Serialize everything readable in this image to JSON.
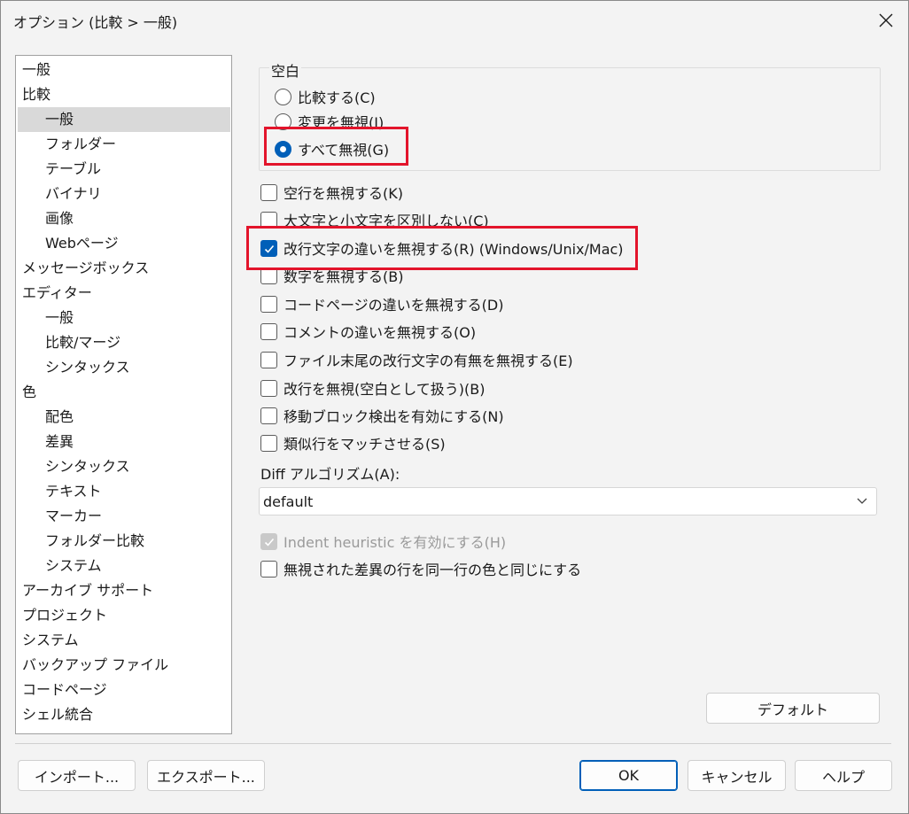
{
  "window": {
    "title": "オプション (比較 > 一般)"
  },
  "tree": [
    {
      "label": "一般",
      "level": 0
    },
    {
      "label": "比較",
      "level": 0
    },
    {
      "label": "一般",
      "level": 1,
      "selected": true
    },
    {
      "label": "フォルダー",
      "level": 1
    },
    {
      "label": "テーブル",
      "level": 1
    },
    {
      "label": "バイナリ",
      "level": 1
    },
    {
      "label": "画像",
      "level": 1
    },
    {
      "label": "Webページ",
      "level": 1
    },
    {
      "label": "メッセージボックス",
      "level": 0
    },
    {
      "label": "エディター",
      "level": 0
    },
    {
      "label": "一般",
      "level": 1
    },
    {
      "label": "比較/マージ",
      "level": 1
    },
    {
      "label": "シンタックス",
      "level": 1
    },
    {
      "label": "色",
      "level": 0
    },
    {
      "label": "配色",
      "level": 1
    },
    {
      "label": "差異",
      "level": 1
    },
    {
      "label": "シンタックス",
      "level": 1
    },
    {
      "label": "テキスト",
      "level": 1
    },
    {
      "label": "マーカー",
      "level": 1
    },
    {
      "label": "フォルダー比較",
      "level": 1
    },
    {
      "label": "システム",
      "level": 1
    },
    {
      "label": "アーカイブ サポート",
      "level": 0
    },
    {
      "label": "プロジェクト",
      "level": 0
    },
    {
      "label": "システム",
      "level": 0
    },
    {
      "label": "バックアップ ファイル",
      "level": 0
    },
    {
      "label": "コードページ",
      "level": 0
    },
    {
      "label": "シェル統合",
      "level": 0
    }
  ],
  "whitespace": {
    "label": "空白",
    "options": [
      {
        "label": "比較する(C)",
        "checked": false
      },
      {
        "label": "変更を無視(I)",
        "checked": false
      },
      {
        "label": "すべて無視(G)",
        "checked": true
      }
    ]
  },
  "checkboxes": [
    {
      "label": "空行を無視する(K)",
      "checked": false
    },
    {
      "label": "大文字と小文字を区別しない(C)",
      "checked": false
    },
    {
      "label": "改行文字の違いを無視する(R) (Windows/Unix/Mac)",
      "checked": true
    },
    {
      "label": "数字を無視する(B)",
      "checked": false
    },
    {
      "label": "コードページの違いを無視する(D)",
      "checked": false
    },
    {
      "label": "コメントの違いを無視する(O)",
      "checked": false
    },
    {
      "label": "ファイル末尾の改行文字の有無を無視する(E)",
      "checked": false
    },
    {
      "label": "改行を無視(空白として扱う)(B)",
      "checked": false
    },
    {
      "label": "移動ブロック検出を有効にする(N)",
      "checked": false
    },
    {
      "label": "類似行をマッチさせる(S)",
      "checked": false
    }
  ],
  "diff_algorithm": {
    "label": "Diff アルゴリズム(A):",
    "value": "default"
  },
  "extra_checkboxes": [
    {
      "label": "Indent heuristic を有効にする(H)",
      "checked": true,
      "disabled": true
    },
    {
      "label": "無視された差異の行を同一行の色と同じにする",
      "checked": false
    }
  ],
  "buttons": {
    "default": "デフォルト",
    "import": "インポート...",
    "export": "エクスポート...",
    "ok": "OK",
    "cancel": "キャンセル",
    "help": "ヘルプ"
  },
  "colors": {
    "accent": "#005fb8",
    "highlight": "#e3142b"
  }
}
